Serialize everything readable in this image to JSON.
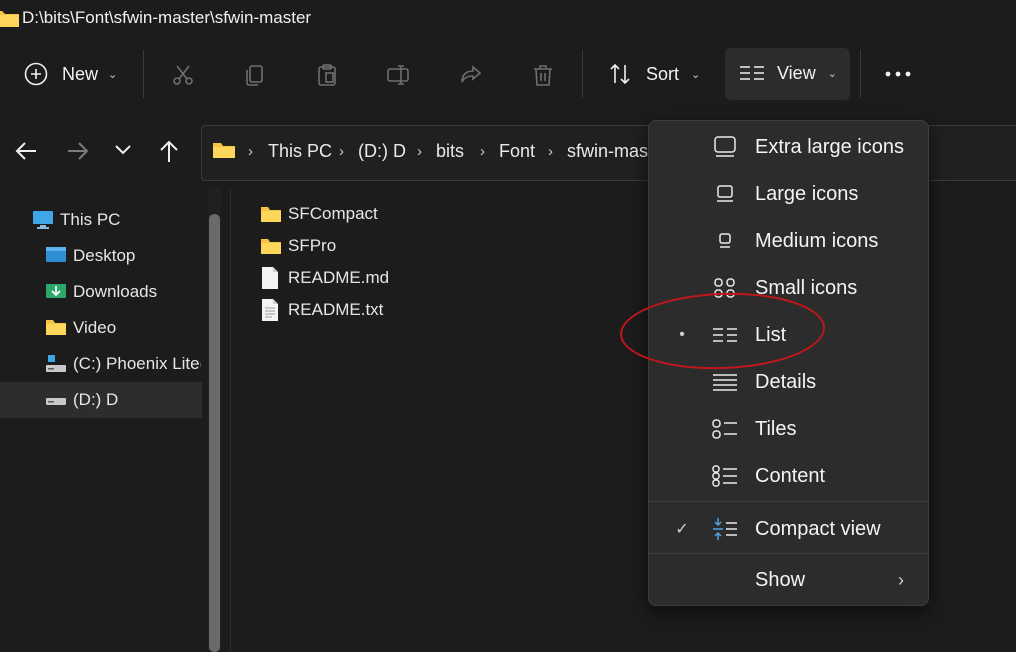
{
  "window": {
    "title": "D:\\bits\\Font\\sfwin-master\\sfwin-master"
  },
  "toolbar": {
    "new_label": "New",
    "sort_label": "Sort",
    "view_label": "View",
    "icons": [
      "cut-icon",
      "copy-icon",
      "paste-icon",
      "rename-icon",
      "share-icon",
      "delete-icon",
      "more-icon"
    ]
  },
  "address": {
    "crumbs": [
      "This PC",
      "(D:) D",
      "bits",
      "Font",
      "sfwin-mas"
    ]
  },
  "nav": {
    "items": [
      {
        "label": "This PC",
        "icon": "monitor-icon"
      },
      {
        "label": "Desktop",
        "icon": "desktop-icon"
      },
      {
        "label": "Downloads",
        "icon": "downloads-icon"
      },
      {
        "label": "Video",
        "icon": "folder-icon"
      },
      {
        "label": "(C:) Phoenix Lite(",
        "icon": "drive-icon"
      },
      {
        "label": "(D:) D",
        "icon": "drive-icon",
        "selected": true
      }
    ]
  },
  "files": [
    {
      "name": "SFCompact",
      "type": "folder"
    },
    {
      "name": "SFPro",
      "type": "folder"
    },
    {
      "name": "README.md",
      "type": "file"
    },
    {
      "name": "README.txt",
      "type": "file"
    }
  ],
  "view_menu": {
    "items": [
      {
        "label": "Extra large icons"
      },
      {
        "label": "Large icons"
      },
      {
        "label": "Medium icons"
      },
      {
        "label": "Small icons"
      },
      {
        "label": "List",
        "selected": true
      },
      {
        "label": "Details"
      },
      {
        "label": "Tiles"
      },
      {
        "label": "Content"
      },
      {
        "label": "Compact view",
        "checked": true
      },
      {
        "label": "Show"
      }
    ]
  },
  "colors": {
    "background": "#1c1c1c",
    "menu": "#2c2c2c",
    "accent_folder": "#f5c542",
    "annotation": "#c3161c",
    "compact_icon_blue": "#4aa3e8"
  }
}
